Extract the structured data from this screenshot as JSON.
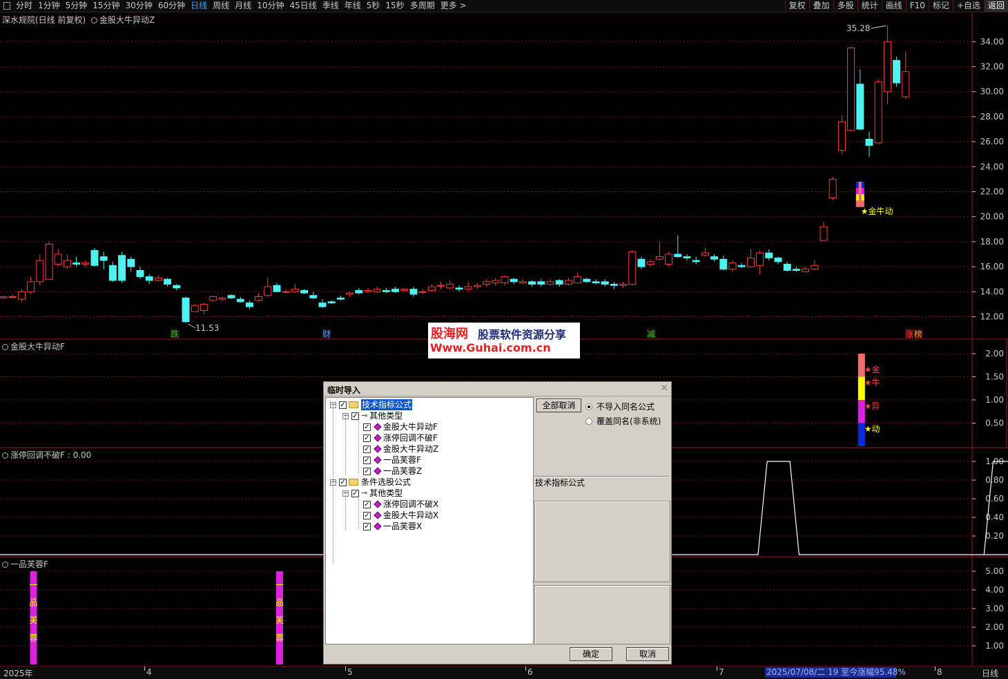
{
  "toolbar": {
    "tabs": [
      "分时",
      "1分钟",
      "5分钟",
      "15分钟",
      "30分钟",
      "60分钟",
      "日线",
      "周线",
      "月线",
      "10分钟",
      "45日线",
      "季线",
      "年线",
      "5秒",
      "15秒",
      "多周期",
      "更多 >"
    ],
    "active_tab": "日线",
    "right_buttons": [
      "复权",
      "叠加",
      "多股",
      "统计",
      "画线",
      "F10",
      "标记",
      "+自选",
      "返回"
    ]
  },
  "main_panel": {
    "title": "深水规院(日线 前复权)",
    "indicator": "金股大牛异动Z",
    "y_ticks": [
      "34.00",
      "32.00",
      "30.00",
      "28.00",
      "26.00",
      "24.00",
      "22.00",
      "20.00",
      "18.00",
      "16.00",
      "14.00",
      "12.00"
    ],
    "high_label": "35.28",
    "low_label": "11.53",
    "signal_label": "★金牛动",
    "markers": [
      {
        "text": "跌",
        "color": "#22cc22"
      },
      {
        "text": "财",
        "color": "#38a0ff"
      },
      {
        "text": "减",
        "color": "#22cc22"
      },
      {
        "text": "涨",
        "color": "#ff4040"
      },
      {
        "text": "榜",
        "color": "#ff9c2a"
      }
    ]
  },
  "panel2": {
    "title": "金股大牛异动F",
    "y_ticks": [
      "2.00",
      "1.50",
      "1.00",
      "0.50"
    ],
    "labels": [
      "★金",
      "★牛",
      "★异",
      "★动"
    ],
    "segment_colors": [
      "#f07070",
      "#ffff00",
      "#e020e0",
      "#0a2ae0"
    ]
  },
  "panel3": {
    "title": "涨停回调不破F : 0.00",
    "y_ticks": [
      "1.00",
      "0.80",
      "0.60",
      "0.40",
      "0.20"
    ]
  },
  "panel4": {
    "title": "一品芙蓉F",
    "y_ticks": [
      "5.00",
      "4.00",
      "3.00",
      "2.00",
      "1.00"
    ],
    "bar_text": [
      "一",
      "品",
      "芙",
      "蓉"
    ]
  },
  "watermark": {
    "title": "股海网",
    "subtitle": "股票软件资源分享",
    "url": "Www.Guhai.com.cn"
  },
  "dialog": {
    "title": "临时导入",
    "tree": [
      {
        "label": "技术指标公式",
        "level": 0,
        "type": "folder",
        "selected": true
      },
      {
        "label": "其他类型",
        "level": 1,
        "type": "key"
      },
      {
        "label": "金股大牛异动F",
        "level": 2,
        "type": "item"
      },
      {
        "label": "涨停回调不破F",
        "level": 2,
        "type": "item"
      },
      {
        "label": "金股大牛异动Z",
        "level": 2,
        "type": "item"
      },
      {
        "label": "一品芙蓉F",
        "level": 2,
        "type": "item"
      },
      {
        "label": "一品芙蓉Z",
        "level": 2,
        "type": "item"
      },
      {
        "label": "条件选股公式",
        "level": 0,
        "type": "folder"
      },
      {
        "label": "其他类型",
        "level": 1,
        "type": "key"
      },
      {
        "label": "涨停回调不破X",
        "level": 2,
        "type": "item"
      },
      {
        "label": "金股大牛异动X",
        "level": 2,
        "type": "item"
      },
      {
        "label": "一品芙蓉X",
        "level": 2,
        "type": "item"
      }
    ],
    "cancel_all": "全部取消",
    "radio_options": [
      "不导入同名公式",
      "覆盖同名(非系统)"
    ],
    "radio_selected": 0,
    "info_label": "技术指标公式",
    "ok": "确定",
    "cancel": "取消"
  },
  "bottom": {
    "dates": [
      "2025年",
      "4",
      "5",
      "6",
      "7",
      "8"
    ],
    "status": "2025/07/08/二 19 至今涨幅95.48%",
    "period": "日线"
  },
  "colors": {
    "up": "#ff3c3c",
    "down": "#4ff0f0",
    "grid": "#7a1212",
    "axis": "#c8c8c8"
  },
  "chart_data": {
    "type": "candlestick",
    "price_range": [
      11,
      35.8
    ],
    "candles": [
      [
        13.5,
        13.6,
        13.7,
        13.4
      ],
      [
        13.6,
        13.6,
        13.8,
        13.5
      ],
      [
        13.4,
        14.0,
        14.2,
        13.2
      ],
      [
        14.0,
        14.8,
        15.2,
        13.8
      ],
      [
        14.8,
        16.5,
        17.0,
        14.5
      ],
      [
        15.0,
        17.8,
        18.0,
        15.0
      ],
      [
        16.2,
        17.0,
        17.4,
        16.0
      ],
      [
        16.0,
        16.5,
        17.0,
        15.8
      ],
      [
        16.3,
        16.2,
        16.8,
        16.0
      ],
      [
        16.2,
        16.3,
        16.5,
        16.0
      ],
      [
        17.3,
        16.1,
        17.5,
        16.0
      ],
      [
        16.8,
        16.5,
        17.2,
        15.8
      ],
      [
        16.1,
        14.9,
        16.4,
        14.8
      ],
      [
        16.9,
        14.9,
        17.2,
        14.7
      ],
      [
        16.6,
        16.0,
        16.8,
        15.6
      ],
      [
        15.7,
        15.2,
        16.0,
        15.0
      ],
      [
        15.2,
        14.9,
        15.4,
        14.6
      ],
      [
        14.9,
        15.1,
        15.3,
        14.8
      ],
      [
        15.0,
        14.6,
        15.1,
        14.4
      ],
      [
        14.5,
        14.3,
        14.6,
        14.1
      ],
      [
        13.5,
        11.6,
        13.6,
        11.5
      ],
      [
        12.4,
        12.9,
        13.0,
        12.4
      ],
      [
        12.5,
        13.0,
        13.1,
        12.2
      ],
      [
        13.3,
        13.6,
        13.7,
        13.2
      ],
      [
        13.4,
        13.5,
        13.6,
        13.2
      ],
      [
        13.7,
        13.5,
        13.8,
        13.4
      ],
      [
        13.4,
        13.2,
        13.6,
        13.1
      ],
      [
        13.1,
        12.8,
        13.3,
        12.6
      ],
      [
        13.3,
        13.6,
        13.9,
        13.2
      ],
      [
        13.7,
        14.4,
        15.1,
        13.6
      ],
      [
        14.5,
        14.0,
        14.7,
        14.0
      ],
      [
        14.0,
        14.0,
        14.2,
        13.9
      ],
      [
        14.0,
        14.2,
        14.6,
        13.9
      ],
      [
        14.1,
        13.9,
        14.2,
        13.8
      ],
      [
        13.7,
        13.5,
        14.0,
        13.4
      ],
      [
        13.1,
        12.8,
        13.4,
        12.7
      ],
      [
        13.2,
        13.1,
        13.3,
        13.0
      ],
      [
        13.5,
        13.4,
        13.7,
        13.3
      ],
      [
        13.8,
        13.9,
        14.0,
        13.6
      ],
      [
        14.1,
        13.9,
        14.3,
        13.8
      ],
      [
        14.0,
        14.1,
        14.3,
        13.9
      ],
      [
        14.0,
        14.2,
        14.4,
        13.9
      ],
      [
        14.1,
        14.0,
        14.3,
        13.9
      ],
      [
        14.2,
        14.0,
        14.4,
        13.9
      ],
      [
        14.1,
        14.2,
        14.3,
        14.0
      ],
      [
        14.2,
        13.8,
        14.4,
        13.6
      ],
      [
        14.0,
        14.0,
        14.2,
        13.8
      ],
      [
        14.1,
        14.4,
        14.6,
        14.0
      ],
      [
        14.5,
        14.5,
        14.8,
        14.2
      ],
      [
        14.3,
        14.6,
        14.9,
        14.2
      ],
      [
        14.3,
        14.2,
        14.5,
        14.0
      ],
      [
        14.2,
        14.4,
        14.8,
        14.0
      ],
      [
        14.4,
        14.5,
        14.7,
        14.2
      ],
      [
        14.6,
        14.8,
        15.0,
        14.4
      ],
      [
        14.7,
        14.9,
        15.1,
        14.5
      ],
      [
        14.7,
        15.2,
        15.3,
        14.5
      ],
      [
        15.0,
        14.8,
        15.1,
        14.6
      ],
      [
        14.7,
        14.8,
        15.0,
        14.6
      ],
      [
        14.8,
        14.6,
        14.9,
        14.4
      ],
      [
        14.8,
        14.6,
        15.0,
        14.4
      ],
      [
        14.6,
        14.8,
        15.0,
        14.5
      ],
      [
        14.9,
        14.6,
        15.0,
        14.4
      ],
      [
        14.6,
        14.9,
        15.1,
        14.5
      ],
      [
        14.7,
        15.2,
        15.5,
        14.7
      ],
      [
        15.0,
        14.8,
        15.1,
        14.7
      ],
      [
        14.8,
        14.7,
        15.0,
        14.6
      ],
      [
        14.8,
        14.6,
        15.0,
        14.4
      ],
      [
        14.6,
        14.5,
        14.8,
        14.2
      ],
      [
        14.5,
        14.6,
        14.8,
        14.3
      ],
      [
        14.6,
        17.2,
        17.3,
        14.5
      ],
      [
        16.6,
        16.0,
        16.8,
        15.8
      ],
      [
        16.2,
        16.4,
        16.6,
        16.0
      ],
      [
        16.6,
        16.8,
        18.0,
        16.5
      ],
      [
        16.2,
        17.0,
        17.2,
        16.0
      ],
      [
        17.0,
        16.8,
        18.5,
        16.7
      ],
      [
        16.8,
        16.7,
        17.0,
        16.5
      ],
      [
        16.5,
        16.4,
        16.8,
        16.2
      ],
      [
        16.9,
        17.1,
        17.5,
        16.8
      ],
      [
        16.8,
        16.6,
        17.0,
        16.4
      ],
      [
        16.6,
        15.8,
        16.9,
        15.7
      ],
      [
        15.8,
        16.3,
        16.5,
        15.6
      ],
      [
        16.1,
        16.0,
        16.3,
        15.9
      ],
      [
        16.0,
        16.7,
        17.4,
        15.9
      ],
      [
        16.1,
        17.1,
        17.3,
        15.4
      ],
      [
        17.1,
        16.7,
        17.4,
        16.5
      ],
      [
        16.7,
        16.4,
        16.8,
        16.2
      ],
      [
        16.2,
        15.7,
        16.4,
        15.6
      ],
      [
        15.8,
        15.7,
        16.0,
        15.6
      ],
      [
        15.6,
        15.8,
        16.0,
        15.6
      ],
      [
        15.8,
        16.1,
        16.5,
        15.7
      ],
      [
        18.1,
        19.2,
        19.6,
        18.1
      ],
      [
        21.5,
        23.0,
        23.2,
        21.3
      ],
      [
        25.3,
        27.6,
        28.1,
        25.0
      ],
      [
        26.9,
        33.5,
        33.6,
        26.8
      ],
      [
        30.6,
        27.0,
        31.8,
        26.9
      ],
      [
        26.2,
        25.7,
        26.8,
        24.8
      ],
      [
        25.9,
        30.8,
        31.0,
        25.8
      ],
      [
        30.0,
        34.0,
        35.3,
        29.0
      ],
      [
        32.5,
        30.7,
        32.8,
        30.4
      ],
      [
        29.6,
        31.6,
        33.2,
        29.4
      ]
    ],
    "panel2_value": 2.0,
    "panel3_peaks": [
      {
        "start": 83.8,
        "end": 86.3,
        "value": 1.0
      },
      {
        "start": 108.6,
        "end": 110.7,
        "value": 1.0
      }
    ],
    "panel4_bars": [
      {
        "x": 3.3,
        "value": 5.0
      },
      {
        "x": 30.3,
        "value": 5.0
      }
    ]
  }
}
